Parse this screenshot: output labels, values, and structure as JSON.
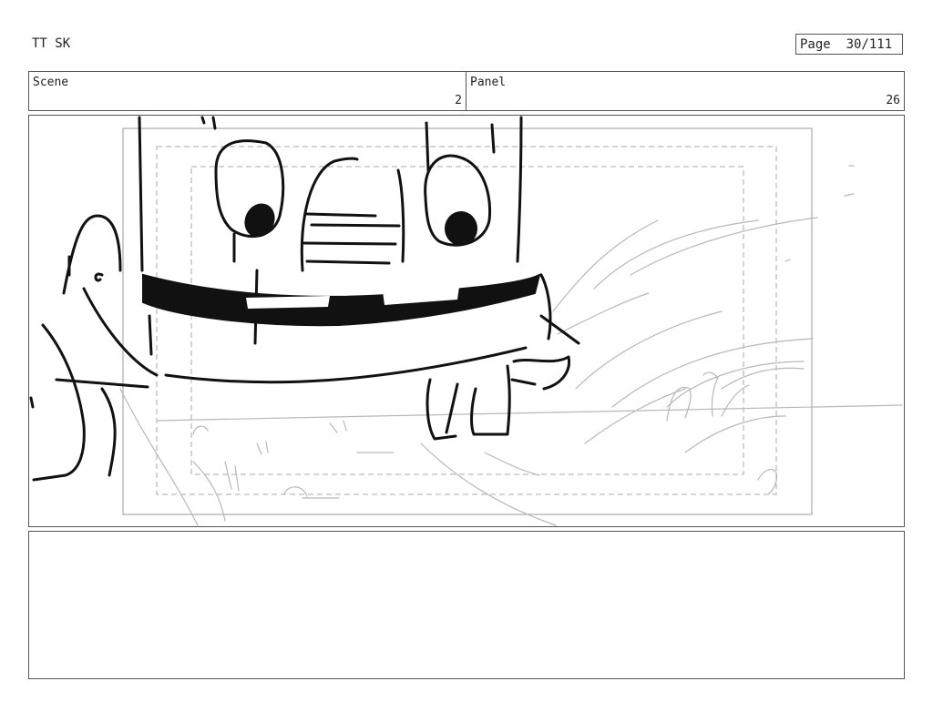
{
  "header": {
    "title": "TT SK",
    "page_label": "Page",
    "page_number": "30/111"
  },
  "scene": {
    "label": "Scene",
    "value": "2"
  },
  "panel": {
    "label": "Panel",
    "value": "26"
  },
  "notes": {
    "text": ""
  }
}
